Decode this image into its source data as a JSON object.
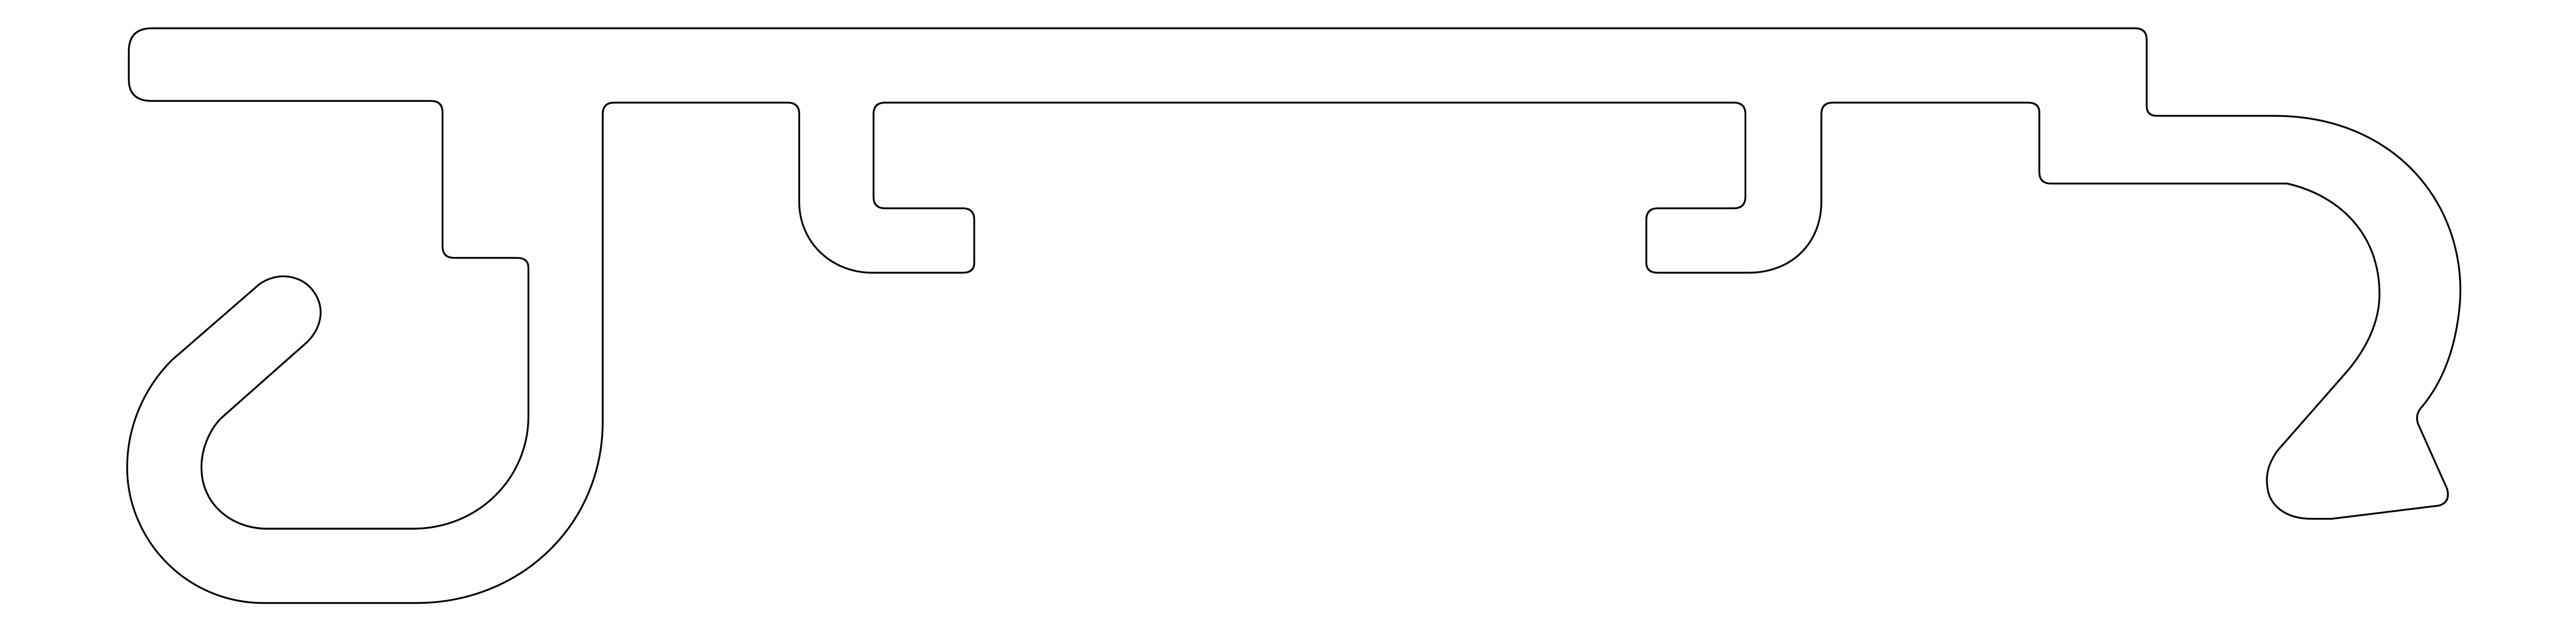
{
  "drawing": {
    "kind": "extrusion-profile-cross-section",
    "background_color": "#ffffff",
    "line_color": "#000000",
    "fill": "none",
    "labels": []
  }
}
